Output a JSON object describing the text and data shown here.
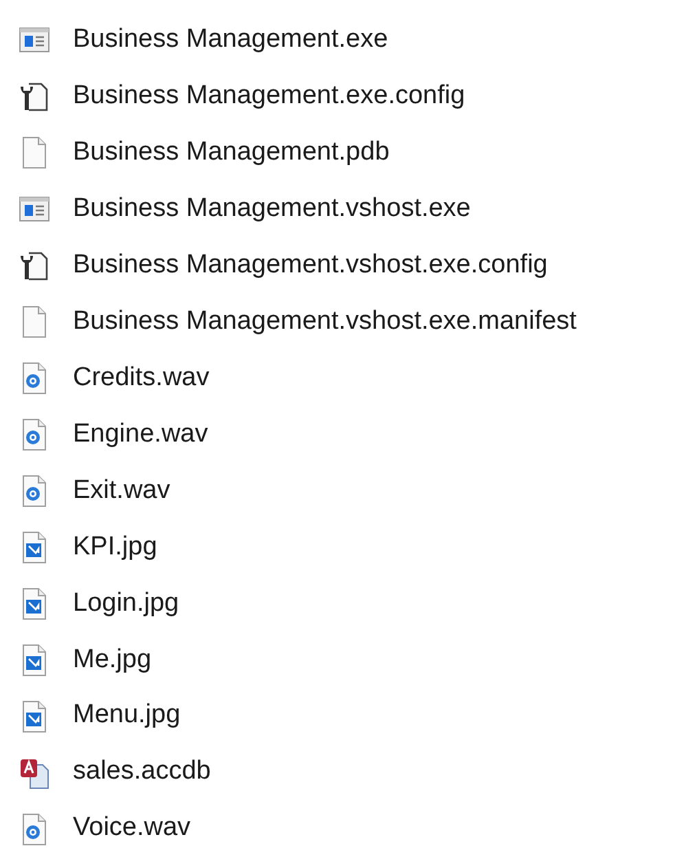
{
  "files": [
    {
      "name": "Business Management.exe",
      "kind": "exe"
    },
    {
      "name": "Business Management.exe.config",
      "kind": "config"
    },
    {
      "name": "Business Management.pdb",
      "kind": "file"
    },
    {
      "name": "Business Management.vshost.exe",
      "kind": "exe"
    },
    {
      "name": "Business Management.vshost.exe.config",
      "kind": "config"
    },
    {
      "name": "Business Management.vshost.exe.manifest",
      "kind": "file"
    },
    {
      "name": "Credits.wav",
      "kind": "audio"
    },
    {
      "name": "Engine.wav",
      "kind": "audio"
    },
    {
      "name": "Exit.wav",
      "kind": "audio"
    },
    {
      "name": "KPI.jpg",
      "kind": "image"
    },
    {
      "name": "Login.jpg",
      "kind": "image"
    },
    {
      "name": "Me.jpg",
      "kind": "image"
    },
    {
      "name": "Menu.jpg",
      "kind": "image"
    },
    {
      "name": "sales.accdb",
      "kind": "database"
    },
    {
      "name": "Voice.wav",
      "kind": "audio"
    }
  ]
}
